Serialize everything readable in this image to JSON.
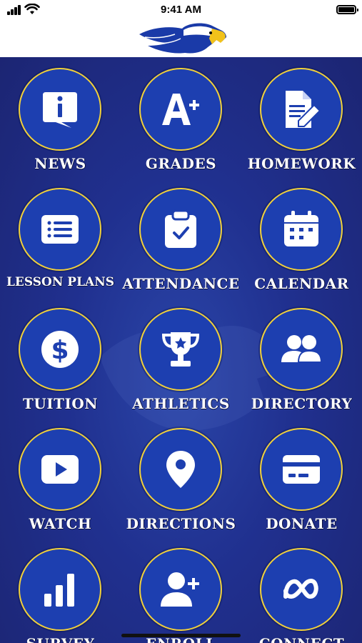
{
  "status_bar": {
    "time": "9:41 AM"
  },
  "tiles": [
    {
      "label": "NEWS",
      "icon": "info-bubble-icon"
    },
    {
      "label": "GRADES",
      "icon": "a-plus-icon"
    },
    {
      "label": "HOMEWORK",
      "icon": "document-pencil-icon"
    },
    {
      "label": "LESSON PLANS",
      "icon": "list-card-icon"
    },
    {
      "label": "ATTENDANCE",
      "icon": "clipboard-check-icon"
    },
    {
      "label": "CALENDAR",
      "icon": "calendar-icon"
    },
    {
      "label": "TUITION",
      "icon": "dollar-coin-icon"
    },
    {
      "label": "ATHLETICS",
      "icon": "trophy-icon"
    },
    {
      "label": "DIRECTORY",
      "icon": "people-icon"
    },
    {
      "label": "WATCH",
      "icon": "video-play-icon"
    },
    {
      "label": "DIRECTIONS",
      "icon": "map-pin-icon"
    },
    {
      "label": "DONATE",
      "icon": "credit-card-icon"
    },
    {
      "label": "SURVEY",
      "icon": "bar-chart-icon"
    },
    {
      "label": "ENROLL",
      "icon": "add-user-icon"
    },
    {
      "label": "CONNECT",
      "icon": "meta-logo-icon"
    }
  ],
  "colors": {
    "background": "#20308f",
    "circle": "#1d3fb0",
    "ring": "#f2d13a",
    "text": "#ffffff"
  }
}
